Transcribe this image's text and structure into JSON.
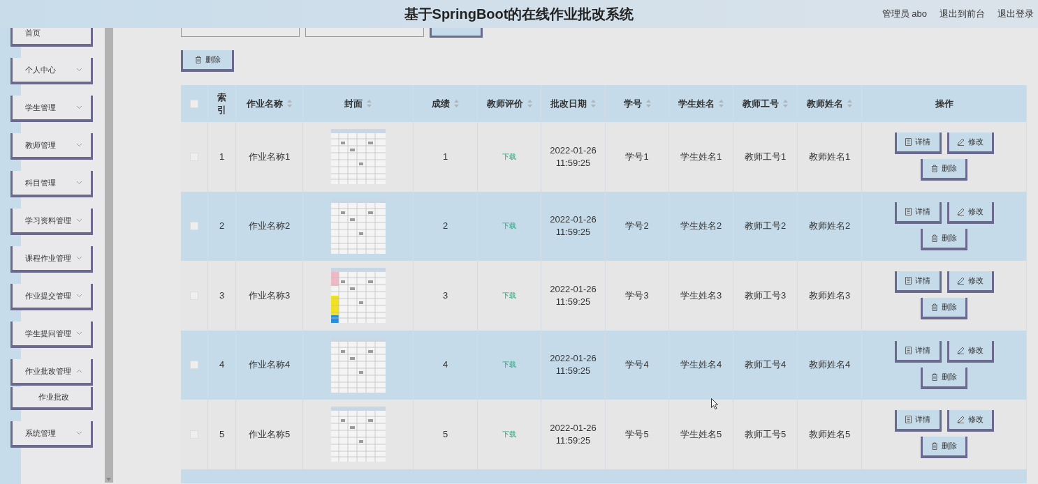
{
  "header": {
    "title": "基于SpringBoot的在线作业批改系统",
    "user": "管理员 abo",
    "links": [
      "退出到前台",
      "退出登录"
    ]
  },
  "sidebar": {
    "items": [
      {
        "label": "首页",
        "expandable": false
      },
      {
        "label": "个人中心",
        "expandable": true,
        "expanded": false
      },
      {
        "label": "学生管理",
        "expandable": true,
        "expanded": false
      },
      {
        "label": "教师管理",
        "expandable": true,
        "expanded": false
      },
      {
        "label": "科目管理",
        "expandable": true,
        "expanded": false
      },
      {
        "label": "学习资料管理",
        "expandable": true,
        "expanded": false
      },
      {
        "label": "课程作业管理",
        "expandable": true,
        "expanded": false
      },
      {
        "label": "作业提交管理",
        "expandable": true,
        "expanded": false
      },
      {
        "label": "学生提问管理",
        "expandable": true,
        "expanded": false
      },
      {
        "label": "作业批改管理",
        "expandable": true,
        "expanded": true,
        "children": [
          {
            "label": "作业批改"
          }
        ]
      },
      {
        "label": "系统管理",
        "expandable": true,
        "expanded": false
      }
    ]
  },
  "toolbar": {
    "delete_button": "删除"
  },
  "table": {
    "select_all_checked": false,
    "columns": [
      {
        "label": "索引",
        "sortable": false
      },
      {
        "label": "作业名称",
        "sortable": true
      },
      {
        "label": "封面",
        "sortable": true
      },
      {
        "label": "成绩",
        "sortable": true
      },
      {
        "label": "教师评价",
        "sortable": true
      },
      {
        "label": "批改日期",
        "sortable": true
      },
      {
        "label": "学号",
        "sortable": true
      },
      {
        "label": "学生姓名",
        "sortable": true
      },
      {
        "label": "教师工号",
        "sortable": true
      },
      {
        "label": "教师姓名",
        "sortable": true
      },
      {
        "label": "操作",
        "sortable": false
      }
    ],
    "rows": [
      {
        "checked": false,
        "index": "1",
        "name": "作业名称1",
        "score": "1",
        "review": "下载",
        "date": "2022-01-26 11:59:25",
        "student_no": "学号1",
        "student_name": "学生姓名1",
        "teacher_no": "教师工号1",
        "teacher_name": "教师姓名1",
        "actions": [
          {
            "kind": "detail",
            "label": "详情"
          },
          {
            "kind": "edit",
            "label": "修改"
          },
          {
            "kind": "delete",
            "label": "删除"
          }
        ]
      },
      {
        "checked": false,
        "index": "2",
        "name": "作业名称2",
        "score": "2",
        "review": "下载",
        "date": "2022-01-26 11:59:25",
        "student_no": "学号2",
        "student_name": "学生姓名2",
        "teacher_no": "教师工号2",
        "teacher_name": "教师姓名2",
        "actions": [
          {
            "kind": "detail",
            "label": "详情"
          },
          {
            "kind": "edit",
            "label": "修改"
          },
          {
            "kind": "delete",
            "label": "删除"
          }
        ]
      },
      {
        "checked": false,
        "index": "3",
        "name": "作业名称3",
        "score": "3",
        "review": "下载",
        "date": "2022-01-26 11:59:25",
        "student_no": "学号3",
        "student_name": "学生姓名3",
        "teacher_no": "教师工号3",
        "teacher_name": "教师姓名3",
        "actions": [
          {
            "kind": "detail",
            "label": "详情"
          },
          {
            "kind": "edit",
            "label": "修改"
          },
          {
            "kind": "delete",
            "label": "删除"
          }
        ]
      },
      {
        "checked": false,
        "index": "4",
        "name": "作业名称4",
        "score": "4",
        "review": "下载",
        "date": "2022-01-26 11:59:25",
        "student_no": "学号4",
        "student_name": "学生姓名4",
        "teacher_no": "教师工号4",
        "teacher_name": "教师姓名4",
        "actions": [
          {
            "kind": "detail",
            "label": "详情"
          },
          {
            "kind": "edit",
            "label": "修改"
          },
          {
            "kind": "delete",
            "label": "删除"
          }
        ]
      },
      {
        "checked": false,
        "index": "5",
        "name": "作业名称5",
        "score": "5",
        "review": "下载",
        "date": "2022-01-26 11:59:25",
        "student_no": "学号5",
        "student_name": "学生姓名5",
        "teacher_no": "教师工号5",
        "teacher_name": "教师姓名5",
        "actions": [
          {
            "kind": "detail",
            "label": "详情"
          },
          {
            "kind": "edit",
            "label": "修改"
          },
          {
            "kind": "delete",
            "label": "删除"
          }
        ]
      }
    ]
  }
}
